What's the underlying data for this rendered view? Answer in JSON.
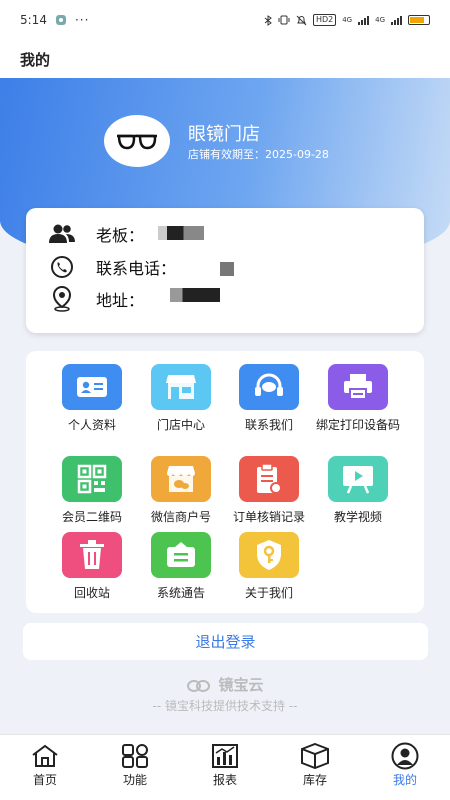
{
  "status_bar": {
    "time": "5:14",
    "hd_label": "HD2",
    "net_label_1": "4G",
    "net_label_2": "4G",
    "battery_level": 0.75
  },
  "page_title": "我的",
  "store": {
    "name": "眼镜门店",
    "validity": "店铺有效期至：2025-09-28"
  },
  "info": {
    "boss_label": "老板：",
    "phone_label": "联系电话：",
    "address_label": "地址："
  },
  "menu": {
    "items": [
      {
        "label": "个人资料",
        "icon": "id-card-icon",
        "color": "#3f8df0"
      },
      {
        "label": "门店中心",
        "icon": "store-icon",
        "color": "#5cc7f2"
      },
      {
        "label": "联系我们",
        "icon": "headset-icon",
        "color": "#3f8df0"
      },
      {
        "label": "绑定打印设备码",
        "icon": "printer-icon",
        "color": "#8b5ce8"
      },
      {
        "label": "会员二维码",
        "icon": "qr-code-icon",
        "color": "#3fc06d"
      },
      {
        "label": "微信商户号",
        "icon": "wechat-shop-icon",
        "color": "#f0a83a"
      },
      {
        "label": "订单核销记录",
        "icon": "clipboard-icon",
        "color": "#ec5a4e"
      },
      {
        "label": "教学视频",
        "icon": "video-icon",
        "color": "#4fd1b8"
      },
      {
        "label": "回收站",
        "icon": "trash-icon",
        "color": "#ef4f7f"
      },
      {
        "label": "系统通告",
        "icon": "notice-icon",
        "color": "#4cc44f"
      },
      {
        "label": "关于我们",
        "icon": "shield-key-icon",
        "color": "#f3c33a"
      }
    ]
  },
  "logout_label": "退出登录",
  "brand": {
    "name": "镜宝云",
    "support": "-- 镜宝科技提供技术支持 --"
  },
  "tabs": [
    {
      "label": "首页",
      "icon": "home-icon",
      "active": false
    },
    {
      "label": "功能",
      "icon": "grid-icon",
      "active": false
    },
    {
      "label": "报表",
      "icon": "chart-icon",
      "active": false
    },
    {
      "label": "库存",
      "icon": "box-icon",
      "active": false
    },
    {
      "label": "我的",
      "icon": "user-icon",
      "active": true
    }
  ],
  "colors": {
    "accent": "#3c7be6",
    "hero_start": "#3d7fe8",
    "hero_end": "#c7dcf6"
  }
}
